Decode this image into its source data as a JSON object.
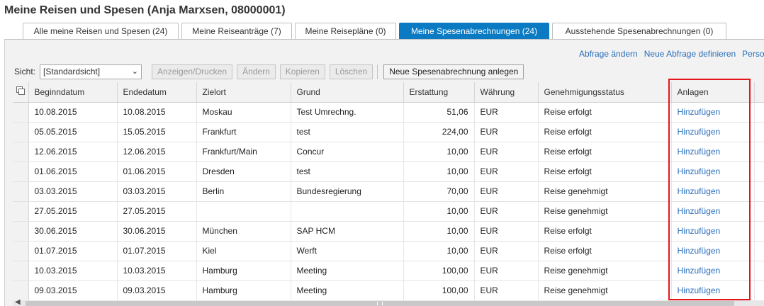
{
  "page": {
    "title": "Meine Reisen und Spesen (Anja Marxsen, 08000001)"
  },
  "tabs": [
    {
      "label": "Alle meine Reisen und Spesen (24)"
    },
    {
      "label": "Meine Reiseanträge (7)"
    },
    {
      "label": "Meine Reisepläne (0)"
    },
    {
      "label": "Meine Spesenabrechnungen (24)"
    },
    {
      "label": "Ausstehende Spesenabrechnungen (0)"
    }
  ],
  "links": {
    "change_query": "Abfrage ändern",
    "new_query": "Neue Abfrage definieren",
    "personalize": "Personalisieren"
  },
  "toolbar": {
    "view_label": "Sicht:",
    "view_value": "[Standardsicht]",
    "display_print": "Anzeigen/Drucken",
    "change": "Ändern",
    "copy": "Kopieren",
    "delete": "Löschen",
    "new_expense": "Neue Spesenabrechnung anlegen"
  },
  "table": {
    "columns": [
      "Beginndatum",
      "Endedatum",
      "Zielort",
      "Grund",
      "Erstattung",
      "Währung",
      "Genehmigungsstatus",
      "Anlagen"
    ],
    "rows": [
      [
        "10.08.2015",
        "10.08.2015",
        "Moskau",
        "Test Umrechng.",
        "51,06",
        "EUR",
        "Reise erfolgt",
        "Hinzufügen"
      ],
      [
        "05.05.2015",
        "15.05.2015",
        "Frankfurt",
        "test",
        "224,00",
        "EUR",
        "Reise erfolgt",
        "Hinzufügen"
      ],
      [
        "12.06.2015",
        "12.06.2015",
        "Frankfurt/Main",
        "Concur",
        "10,00",
        "EUR",
        "Reise erfolgt",
        "Hinzufügen"
      ],
      [
        "01.06.2015",
        "01.06.2015",
        "Dresden",
        "test",
        "10,00",
        "EUR",
        "Reise erfolgt",
        "Hinzufügen"
      ],
      [
        "03.03.2015",
        "03.03.2015",
        "Berlin",
        "Bundesregierung",
        "70,00",
        "EUR",
        "Reise genehmigt",
        "Hinzufügen"
      ],
      [
        "27.05.2015",
        "27.05.2015",
        "",
        "",
        "10,00",
        "EUR",
        "Reise genehmigt",
        "Hinzufügen"
      ],
      [
        "30.06.2015",
        "30.06.2015",
        "München",
        "SAP HCM",
        "10,00",
        "EUR",
        "Reise erfolgt",
        "Hinzufügen"
      ],
      [
        "01.07.2015",
        "01.07.2015",
        "Kiel",
        "Werft",
        "10,00",
        "EUR",
        "Reise erfolgt",
        "Hinzufügen"
      ],
      [
        "10.03.2015",
        "10.03.2015",
        "Hamburg",
        "Meeting",
        "100,00",
        "EUR",
        "Reise genehmigt",
        "Hinzufügen"
      ],
      [
        "09.03.2015",
        "09.03.2015",
        "Hamburg",
        "Meeting",
        "100,00",
        "EUR",
        "Reise genehmigt",
        "Hinzufügen"
      ]
    ]
  },
  "colors": {
    "accent": "#0a7bc2",
    "link": "#2a6ebb",
    "highlight": "#e8141b"
  }
}
